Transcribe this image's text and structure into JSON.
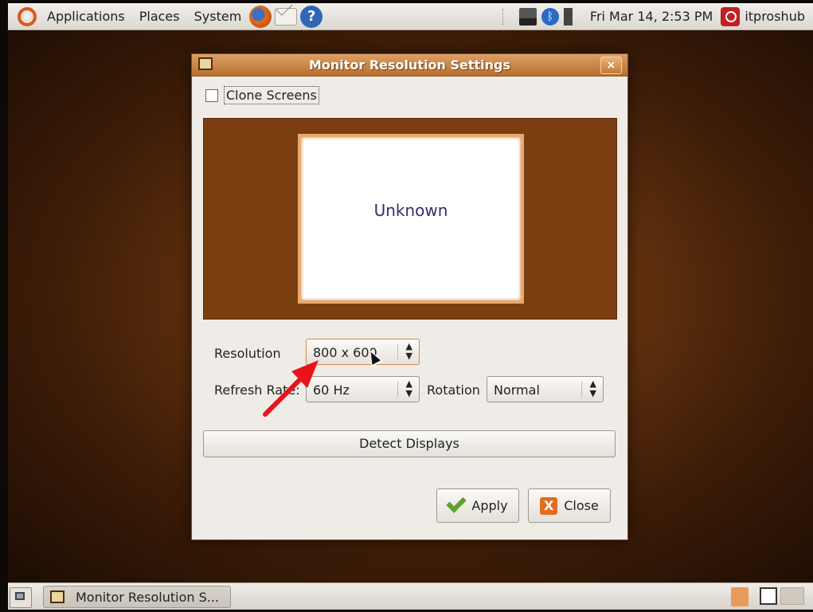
{
  "top_panel": {
    "menus": [
      "Applications",
      "Places",
      "System"
    ],
    "clock": "Fri Mar 14,  2:53 PM",
    "username": "itproshub",
    "help_glyph": "?"
  },
  "dialog": {
    "title": "Monitor Resolution Settings",
    "close_glyph": "×",
    "clone_label": "Clone Screens",
    "clone_checked": false,
    "monitor_name": "Unknown",
    "resolution_label": "Resolution",
    "resolution_value": "800 x 600",
    "refresh_label": "Refresh Rate:",
    "refresh_value": "60 Hz",
    "rotation_label": "Rotation",
    "rotation_value": "Normal",
    "detect_label": "Detect Displays",
    "apply_label": "Apply",
    "close_label": "Close",
    "close_icon_glyph": "X"
  },
  "bottom_panel": {
    "task_label": "Monitor Resolution S..."
  },
  "colors": {
    "desktop_bg": "#6a3610",
    "titlebar": "#c98442",
    "monitor_area": "#7a3e10",
    "annotation_arrow": "#e8141a"
  },
  "icons": [
    "ubuntu-logo-icon",
    "firefox-icon",
    "mail-icon",
    "help-icon",
    "network-icon",
    "bluetooth-icon",
    "volume-icon",
    "power-icon",
    "display-icon",
    "checkmark-icon",
    "close-icon",
    "trash-icon",
    "workspace-icon",
    "cursor-icon",
    "arrow-icon"
  ]
}
